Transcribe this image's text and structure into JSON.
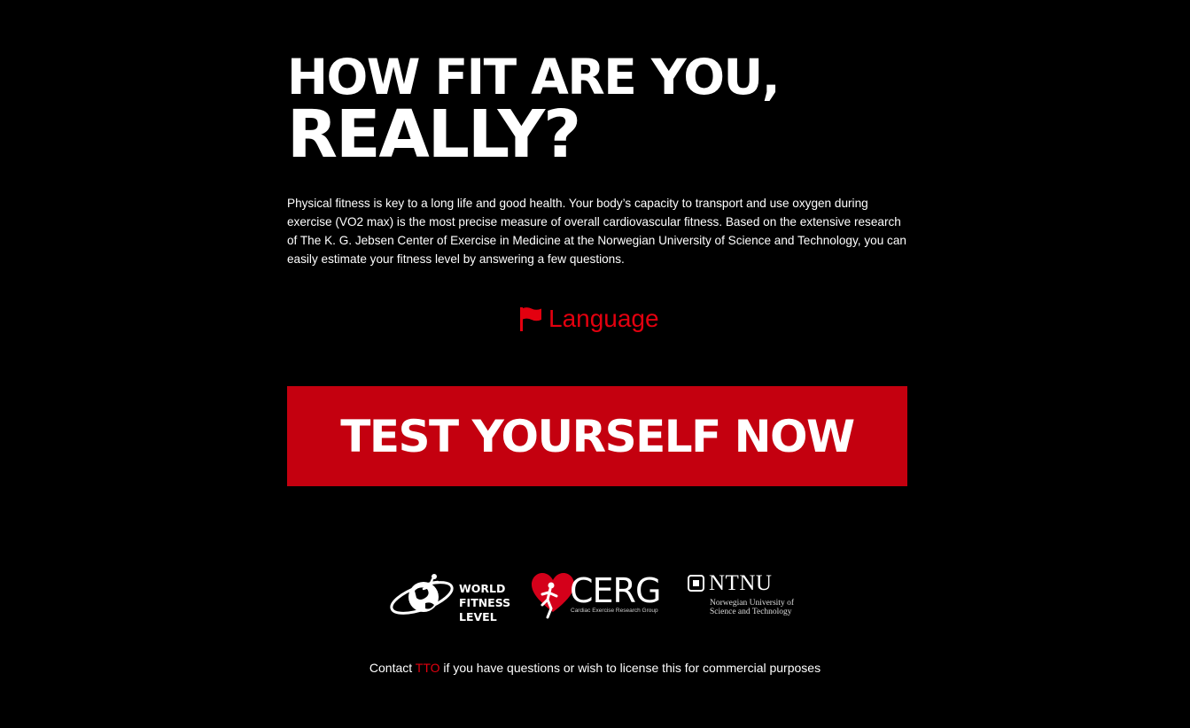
{
  "hero": {
    "title_line1": "HOW FIT ARE YOU,",
    "title_line2": "REALLY?",
    "intro": "Physical fitness is key to a long life and good health. Your body’s capacity to transport and use oxygen during exercise (VO2 max) is the most precise measure of overall cardiovascular fitness. Based on the extensive research of The K. G. Jebsen Center of Exercise in Medicine at the Norwegian University of Science and Technology, you can easily estimate your fitness level by answering a few questions."
  },
  "language": {
    "label": "Language",
    "icon": "flag-icon"
  },
  "cta": {
    "label": "TEST YOURSELF NOW"
  },
  "logos": {
    "world_fitness_level": {
      "line1": "WORLD",
      "line2": "FITNESS",
      "line3": "LEVEL"
    },
    "cerg": {
      "name": "CERG",
      "subtitle": "Cardiac Exercise Research Group"
    },
    "ntnu": {
      "name": "NTNU",
      "subtitle_line1": "Norwegian University of",
      "subtitle_line2": "Science and Technology"
    }
  },
  "footer": {
    "prefix": "Contact ",
    "link_label": "TTO",
    "suffix": " if you have questions or wish to license this for commercial purposes"
  },
  "colors": {
    "background": "#000000",
    "accent": "#e3000f",
    "cta_background": "#c4000f",
    "text": "#ffffff"
  }
}
